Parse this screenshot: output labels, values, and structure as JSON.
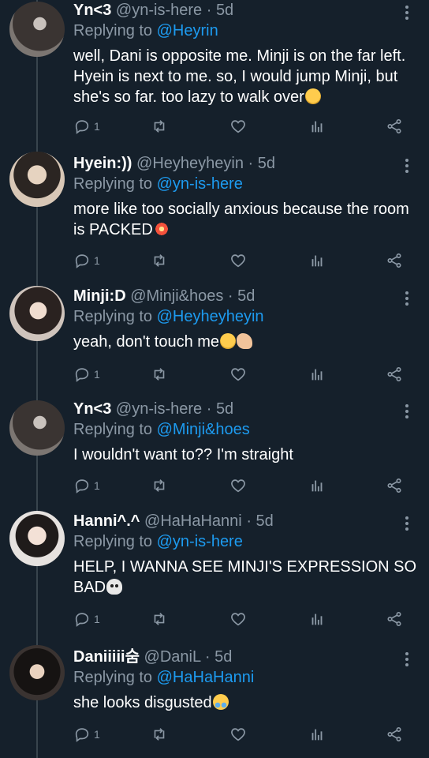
{
  "replying_prefix": "Replying to ",
  "tweets": [
    {
      "name": "Yn<3",
      "handle": "@yn-is-here",
      "time": "5d",
      "replying_to": "@Heyrin",
      "text": "well, Dani is opposite me. Minji is on the far left. Hyein is next to me. so, I would jump Minji, but she's so far. too lazy to walk over",
      "emoji": "disappointed-face",
      "reply_count": "1"
    },
    {
      "name": "Hyein:))",
      "handle": "@Heyheyheyin",
      "time": "5d",
      "replying_to": "@yn-is-here",
      "text": "more like too socially anxious because the room is PACKED",
      "emoji": "collision",
      "reply_count": "1"
    },
    {
      "name": "Minji:D",
      "handle": "@Minji&hoes",
      "time": "5d",
      "replying_to": "@Heyheyheyin",
      "text": "yeah, don't touch me",
      "emoji": "grin-and-flexed-biceps",
      "reply_count": "1"
    },
    {
      "name": "Yn<3",
      "handle": "@yn-is-here",
      "time": "5d",
      "replying_to": "@Minji&hoes",
      "text": "I wouldn't want to?? I'm straight",
      "emoji": "",
      "reply_count": "1"
    },
    {
      "name": "Hanni^.^",
      "handle": "@HaHaHanni",
      "time": "5d",
      "replying_to": "@yn-is-here",
      "text": "HELP, I WANNA SEE MINJI'S EXPRESSION SO BAD",
      "emoji": "skull",
      "reply_count": "1"
    },
    {
      "name": "Daniiiii숨",
      "handle": "@DaniL",
      "time": "5d",
      "replying_to": "@HaHaHanni",
      "text": "she looks disgusted",
      "emoji": "crying-face",
      "reply_count": "1"
    }
  ],
  "icons": {
    "reply": "reply-bubble-icon",
    "retweet": "retweet-icon",
    "like": "heart-icon",
    "analytics": "analytics-icon",
    "share": "share-icon",
    "more": "more-vertical-icon"
  },
  "colors": {
    "background": "#15202b",
    "link": "#1d9bf0",
    "muted": "#8b98a5",
    "thread_line": "#38444d"
  }
}
